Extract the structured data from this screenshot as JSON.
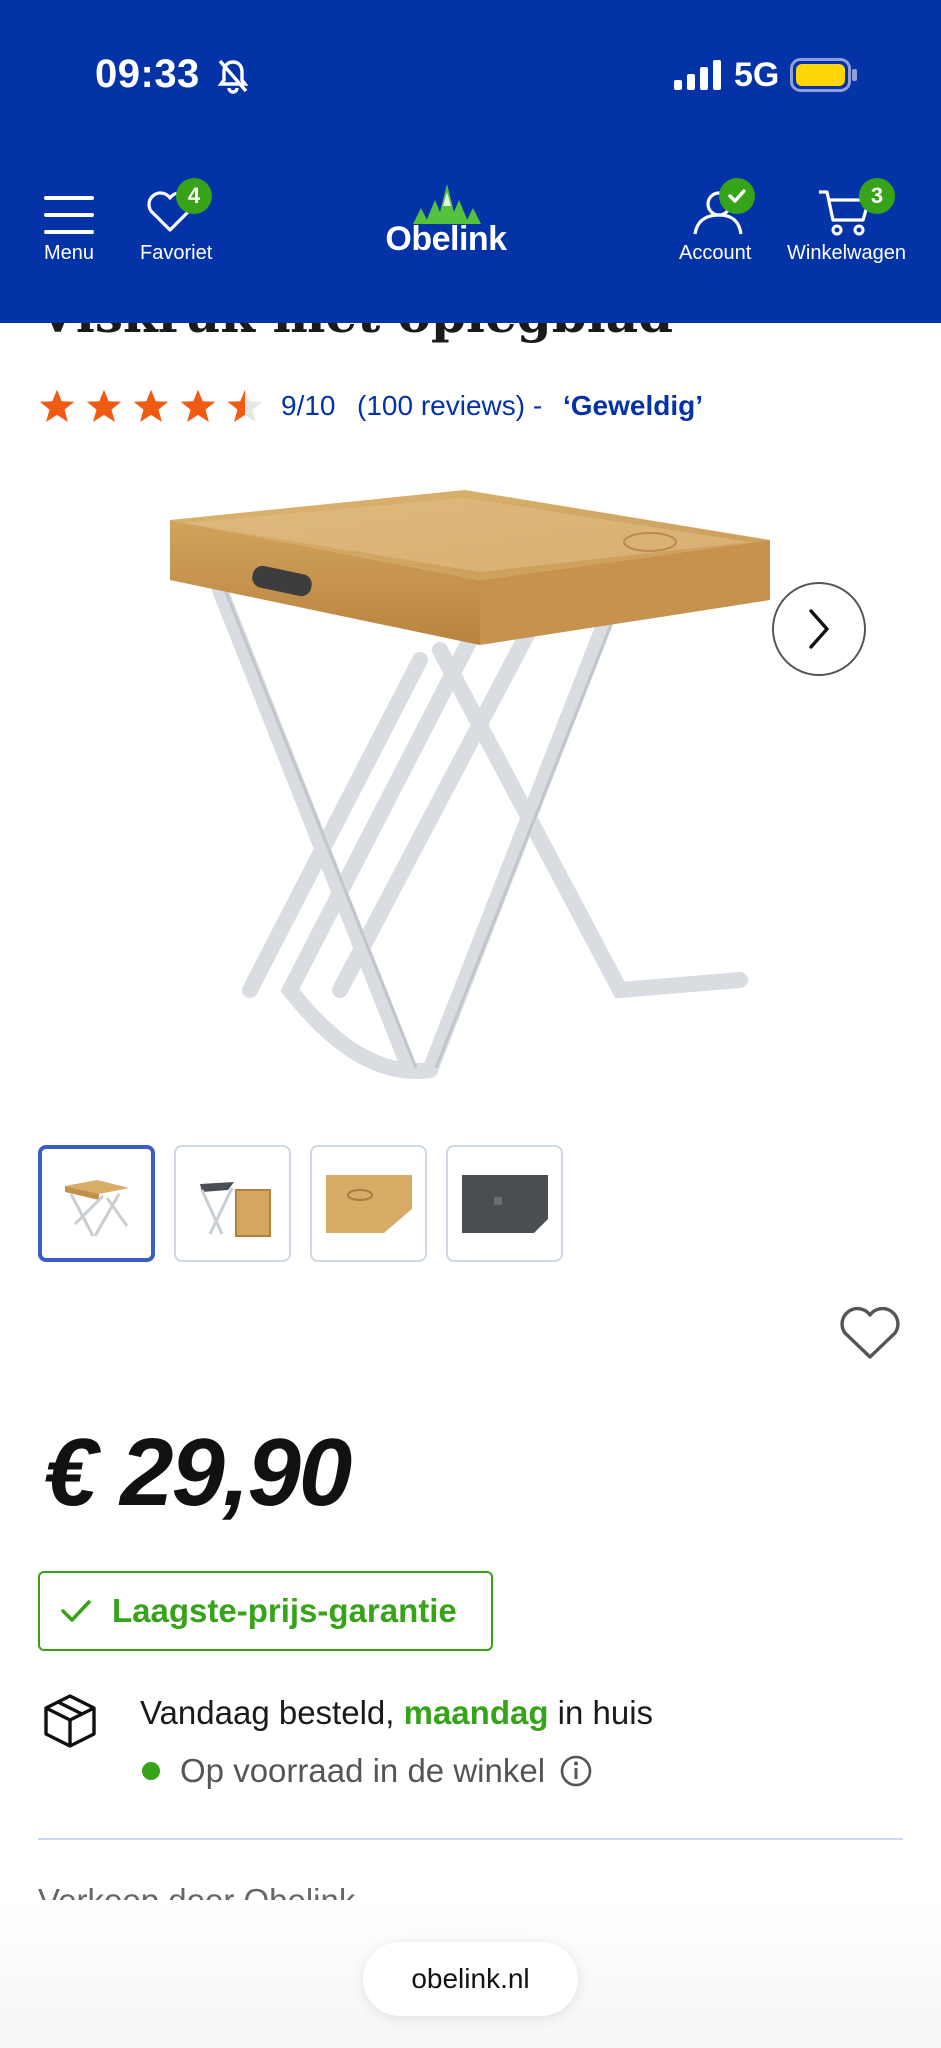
{
  "status_bar": {
    "time": "09:33",
    "network": "5G"
  },
  "header": {
    "menu_label": "Menu",
    "favorites_label": "Favoriet",
    "favorites_count": "4",
    "logo_text": "Obelink",
    "account_label": "Account",
    "cart_label": "Winkelwagen",
    "cart_count": "3"
  },
  "product": {
    "title": "Viskruk met oplegblad",
    "rating_score": "9/10",
    "rating_reviews": "(100 reviews) -",
    "rating_verdict": "‘Geweldig’",
    "rating_stars": 4.5,
    "price": "€ 29,90",
    "guarantee": "Laagste-prijs-garantie",
    "delivery_prefix": "Vandaag besteld, ",
    "delivery_day": "maandag",
    "delivery_suffix": " in huis",
    "stock": "Op voorraad in de winkel",
    "seller": "Verkoop door Obelink"
  },
  "colors": {
    "brand_blue": "#0433a8",
    "accent_green": "#36a319",
    "star_orange": "#f15a13"
  },
  "browser": {
    "url": "obelink.nl"
  }
}
